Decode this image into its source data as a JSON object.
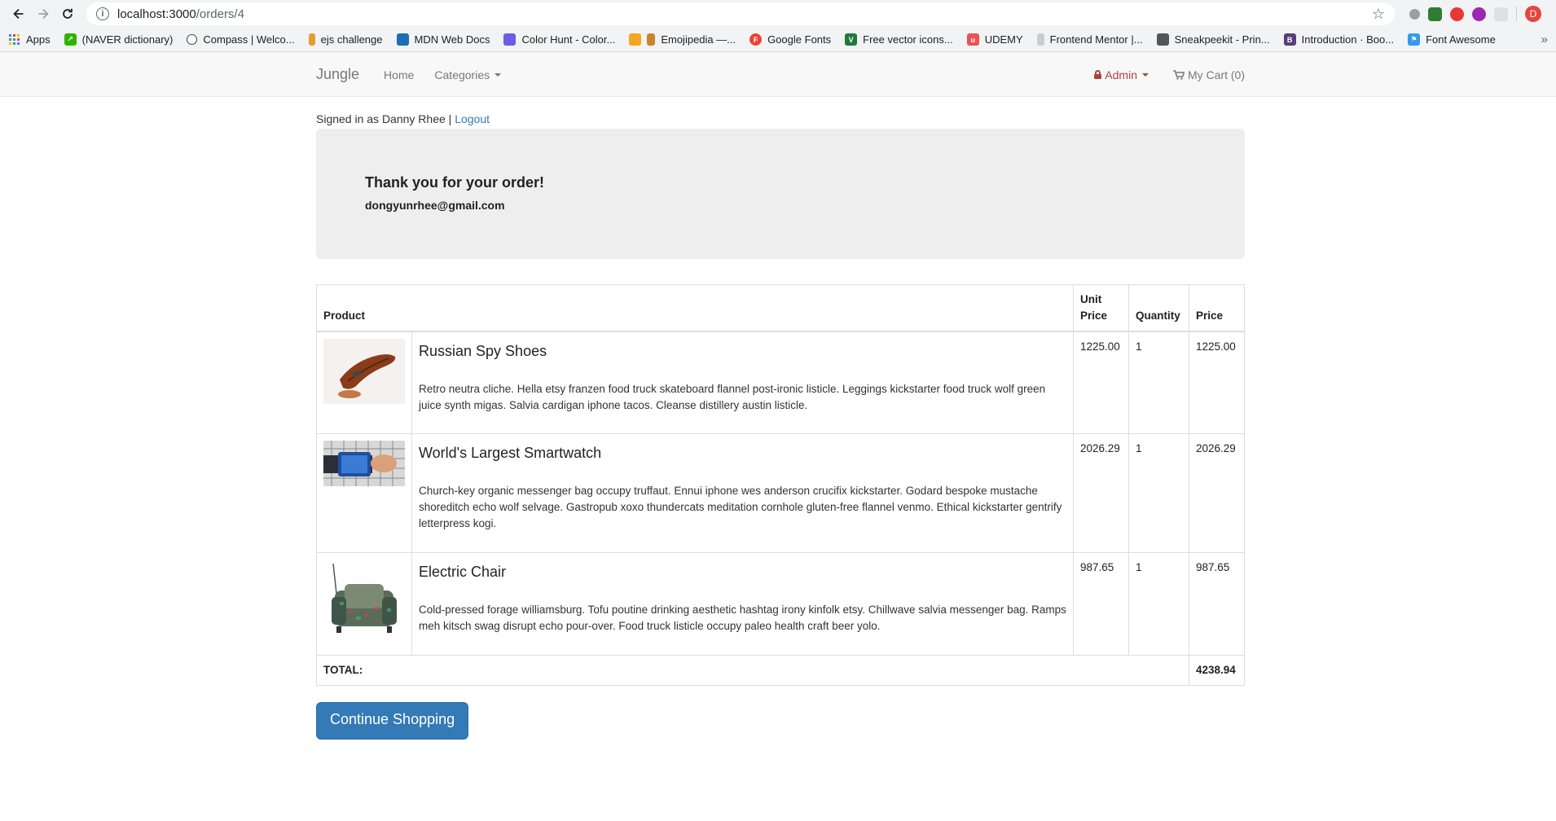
{
  "browser": {
    "url_host": "localhost:3000",
    "url_path": "/orders/4",
    "profile_initial": "D",
    "bookmarks": [
      {
        "label": "Apps",
        "color": "#4285f4"
      },
      {
        "label": "(NAVER dictionary)",
        "color": "#2db400"
      },
      {
        "label": "Compass | Welco...",
        "color": "#444444"
      },
      {
        "label": "ejs challenge",
        "color": "#e0a030"
      },
      {
        "label": "MDN Web Docs",
        "color": "#1a6fb5"
      },
      {
        "label": "Color Hunt - Color...",
        "color": "#6c5ce7"
      },
      {
        "label": "Emojipedia —...",
        "color": "#f5a623"
      },
      {
        "label": "Google Fonts",
        "color": "#ea4335"
      },
      {
        "label": "Free vector icons...",
        "color": "#1f7a3a"
      },
      {
        "label": "UDEMY",
        "color": "#ec5252"
      },
      {
        "label": "Frontend Mentor |...",
        "color": "#cccccc"
      },
      {
        "label": "Sneakpeekit - Prin...",
        "color": "#555555"
      },
      {
        "label": "Introduction · Boo...",
        "color": "#563d7c"
      },
      {
        "label": "Font Awesome",
        "color": "#339af0"
      }
    ],
    "more": "»"
  },
  "navbar": {
    "brand": "Jungle",
    "home": "Home",
    "categories": "Categories",
    "admin": "Admin",
    "cart": "My Cart (0)"
  },
  "signin": {
    "text": "Signed in as Danny Rhee | ",
    "logout": "Logout"
  },
  "order": {
    "heading": "Thank you for your order!",
    "email": "dongyunrhee@gmail.com"
  },
  "table": {
    "headers": {
      "product": "Product",
      "unit_price": "Unit Price",
      "quantity": "Quantity",
      "price": "Price"
    },
    "items": [
      {
        "name": "Russian Spy Shoes",
        "description": "Retro neutra cliche. Hella etsy franzen food truck skateboard flannel post-ironic listicle. Leggings kickstarter food truck wolf green juice synth migas. Salvia cardigan iphone tacos. Cleanse distillery austin listicle.",
        "unit_price": "1225.00",
        "quantity": "1",
        "price": "1225.00"
      },
      {
        "name": "World's Largest Smartwatch",
        "description": "Church-key organic messenger bag occupy truffaut. Ennui iphone wes anderson crucifix kickstarter. Godard bespoke mustache shoreditch echo wolf selvage. Gastropub xoxo thundercats meditation cornhole gluten-free flannel venmo. Ethical kickstarter gentrify letterpress kogi.",
        "unit_price": "2026.29",
        "quantity": "1",
        "price": "2026.29"
      },
      {
        "name": "Electric Chair",
        "description": "Cold-pressed forage williamsburg. Tofu poutine drinking aesthetic hashtag irony kinfolk etsy. Chillwave salvia messenger bag. Ramps meh kitsch swag disrupt echo pour-over. Food truck listicle occupy paleo health craft beer yolo.",
        "unit_price": "987.65",
        "quantity": "1",
        "price": "987.65"
      }
    ],
    "total_label": "TOTAL:",
    "total_value": "4238.94"
  },
  "continue_button": "Continue Shopping"
}
